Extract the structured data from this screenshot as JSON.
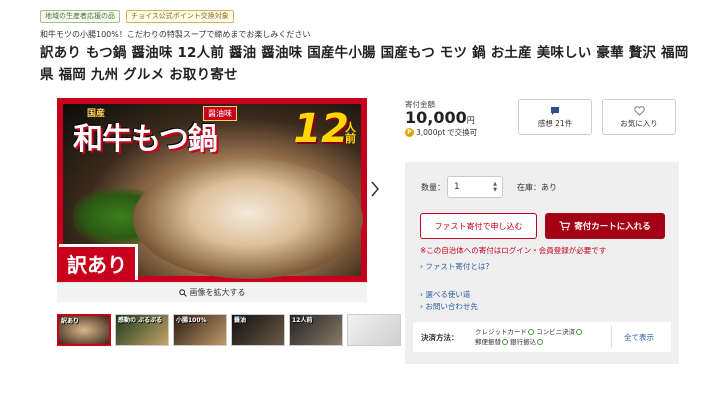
{
  "tags": [
    "地域の生産者応援の品",
    "チョイス公式ポイント交換対象"
  ],
  "subtitle": "和牛モツの小腸100%！こだわりの特製スープで締めまでお楽しみください",
  "title": "訳あり もつ鍋 醤油味 12人前 醤油 醤油味 国産牛小腸 国産もつ モツ 鍋 お土産 美味しい 豪華 贅沢 福岡県 福岡 九州 グルメ お取り寄せ",
  "main_image": {
    "kokusan": "国産",
    "title_text": "和牛もつ鍋",
    "shoyu": "醤油味",
    "number": "12",
    "nin": "人前",
    "wake": "訳あり"
  },
  "zoom_label": "画像を拡大する",
  "thumbnails": [
    {
      "text": "訳あり"
    },
    {
      "text": "感動の ぷるぷる"
    },
    {
      "text": "小腸100%"
    },
    {
      "text": "醤油"
    },
    {
      "text": "12人前"
    },
    {
      "text": ""
    },
    {
      "text": ""
    }
  ],
  "price": {
    "label": "寄付金額",
    "amount": "10,000",
    "unit": "円",
    "points_icon": "P",
    "points": "3,000pt",
    "points_suffix": "で交換可"
  },
  "buttons": {
    "kansou": "感想 21件",
    "favorite": "お気に入り",
    "fast": "ファスト寄付で申し込む",
    "cart": "寄付カートに入れる"
  },
  "quantity": {
    "label": "数量：",
    "value": "1"
  },
  "stock": "在庫：あり",
  "notice": "※この自治体への寄付はログイン・会員登録が必要です",
  "links": {
    "fast_about": "ファスト寄付とは?",
    "usage": "選べる使い道",
    "inquiry": "お問い合わせ先"
  },
  "payment": {
    "label": "決済方法：",
    "line1a": "クレジットカード",
    "line1b": "コンビニ決済",
    "line2a": "郵便振替",
    "line2b": "銀行振込",
    "show_all": "全て表示"
  },
  "colors": {
    "accent_red": "#c8001b",
    "cart_red": "#a40016",
    "link_blue": "#2a5d9f"
  }
}
